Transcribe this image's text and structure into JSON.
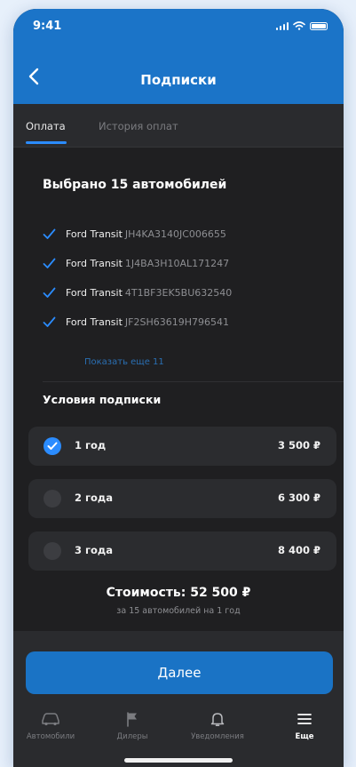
{
  "status_bar": {
    "time": "9:41"
  },
  "header": {
    "title": "Подписки"
  },
  "tabs": [
    {
      "label": "Оплата",
      "active": true
    },
    {
      "label": "История оплат",
      "active": false
    }
  ],
  "selection": {
    "title": "Выбрано 15 автомобилей",
    "cars": [
      {
        "model": "Ford Transit",
        "vin": "JH4KA3140JC006655"
      },
      {
        "model": "Ford Transit",
        "vin": "1J4BA3H10AL171247"
      },
      {
        "model": "Ford Transit",
        "vin": "4T1BF3EK5BU632540"
      },
      {
        "model": "Ford Transit",
        "vin": "JF2SH63619H796541"
      }
    ],
    "show_more_label": "Показать еще 11"
  },
  "terms": {
    "title": "Условия подписки",
    "plans": [
      {
        "label": "1 год",
        "price": "3 500 ₽",
        "selected": true
      },
      {
        "label": "2 года",
        "price": "6 300 ₽",
        "selected": false
      },
      {
        "label": "3 года",
        "price": "8 400 ₽",
        "selected": false
      }
    ]
  },
  "cost": {
    "label": "Стоимость:",
    "value": "52 500 ₽",
    "subtitle": "за 15 автомобилей на 1 год"
  },
  "next_button": {
    "label": "Далее"
  },
  "tabbar": [
    {
      "label": "Автомобили",
      "icon": "car-icon",
      "active": false
    },
    {
      "label": "Дилеры",
      "icon": "flag-icon",
      "active": false
    },
    {
      "label": "Уведомления",
      "icon": "bell-icon",
      "active": false
    },
    {
      "label": "Еще",
      "icon": "menu-icon",
      "active": true
    }
  ],
  "colors": {
    "accent": "#2b8cff",
    "header_blue": "#1b74c8",
    "background": "#1f1f21",
    "card": "#2b2c2f"
  }
}
